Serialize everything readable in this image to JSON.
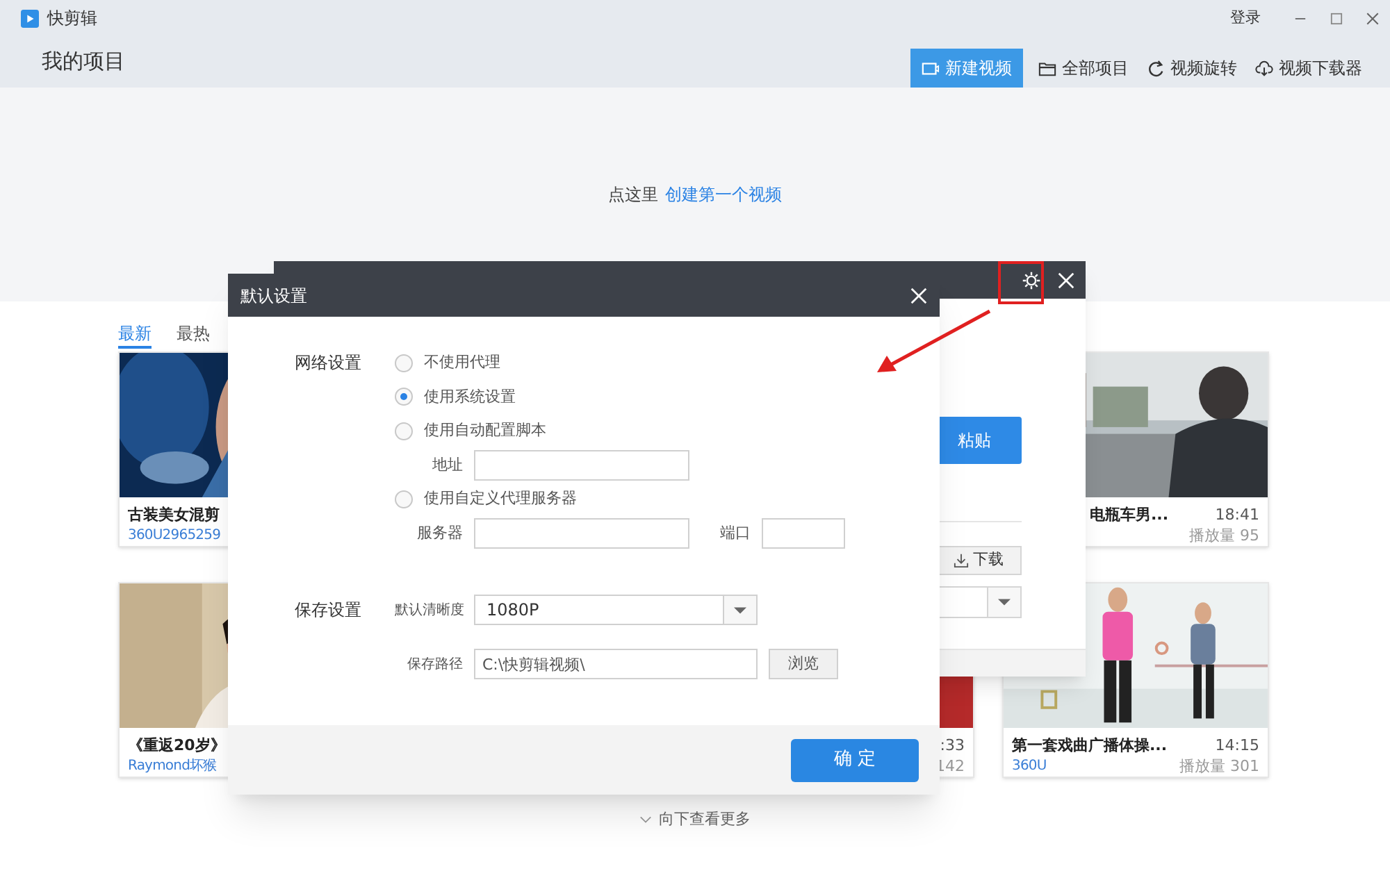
{
  "app": {
    "name": "快剪辑",
    "section": "我的项目",
    "login": "登录"
  },
  "nav": [
    {
      "label": "新建视频",
      "selected": true
    },
    {
      "label": "全部项目",
      "selected": false
    },
    {
      "label": "视频旋转",
      "selected": false
    },
    {
      "label": "视频下载器",
      "selected": false
    }
  ],
  "hero": {
    "prompt": "点这里",
    "link": "创建第一个视频"
  },
  "feed_tabs": [
    {
      "label": "最新",
      "selected": true
    },
    {
      "label": "最热",
      "selected": false
    }
  ],
  "videos": [
    {
      "title": "古装美女混剪",
      "author": "360U2965259"
    },
    {
      "title": "电瓶车男...",
      "duration": "18:41",
      "plays": "播放量 95"
    },
    {
      "title": "《重返20岁》",
      "author": "Raymond坏猴"
    },
    {
      "duration": ":33",
      "plays": "142"
    },
    {
      "title": "第一套戏曲广播体操...",
      "author": "360U",
      "duration": "14:15",
      "plays": "播放量 301"
    }
  ],
  "load_more": "向下查看更多",
  "back_dialog": {
    "paste": "粘贴",
    "download": "下载"
  },
  "settings_dialog": {
    "title": "默认设置",
    "network": {
      "label": "网络设置",
      "options": [
        {
          "label": "不使用代理",
          "selected": false
        },
        {
          "label": "使用系统设置",
          "selected": true
        },
        {
          "label": "使用自动配置脚本",
          "selected": false,
          "fields": [
            {
              "label": "地址"
            }
          ]
        },
        {
          "label": "使用自定义代理服务器",
          "selected": false,
          "fields": [
            {
              "label": "服务器"
            },
            {
              "label": "端口"
            }
          ]
        }
      ]
    },
    "save": {
      "label": "保存设置",
      "quality": {
        "label": "默认清晰度",
        "value": "1080P"
      },
      "path": {
        "label": "保存路径",
        "value": "C:\\快剪辑视频\\",
        "browse": "浏览"
      }
    },
    "confirm": "确 定"
  }
}
